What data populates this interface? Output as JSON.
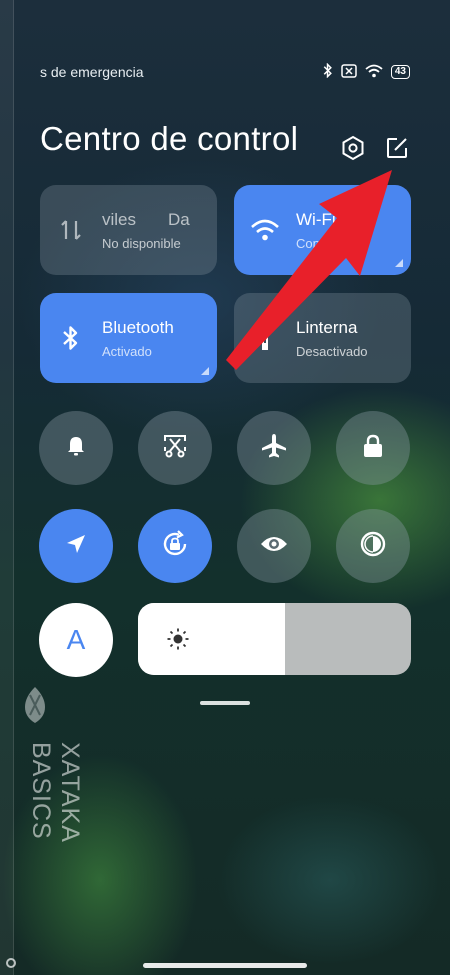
{
  "status_bar": {
    "carrier_text": "s de emergencia",
    "battery_level": "43"
  },
  "panel": {
    "title": "Centro de control"
  },
  "top_actions": [
    {
      "name": "settings",
      "icon": "settings-hexagon-icon"
    },
    {
      "name": "edit",
      "icon": "edit-square-icon"
    }
  ],
  "tiles": {
    "mobile_data": {
      "name": "viles",
      "name_suffix": "Da",
      "state": "No disponible",
      "active": false,
      "icon": "mobile-data-arrows-icon"
    },
    "wifi": {
      "name": "Wi-Fi",
      "state": "Conectado",
      "active": true,
      "icon": "wifi-icon"
    },
    "bluetooth": {
      "name": "Bluetooth",
      "state": "Activado",
      "active": true,
      "icon": "bluetooth-icon"
    },
    "flashlight": {
      "name": "Linterna",
      "state": "Desactivado",
      "active": false,
      "icon": "flashlight-icon"
    }
  },
  "toggles_row1": [
    {
      "name": "sound",
      "icon": "bell-icon",
      "active": false
    },
    {
      "name": "screenshot",
      "icon": "screenshot-scissors-icon",
      "active": false
    },
    {
      "name": "airplane",
      "icon": "airplane-icon",
      "active": false
    },
    {
      "name": "lock",
      "icon": "lock-icon",
      "active": false
    }
  ],
  "toggles_row2": [
    {
      "name": "location",
      "icon": "location-arrow-icon",
      "active": true
    },
    {
      "name": "rotation-lock",
      "icon": "rotation-lock-icon",
      "active": true
    },
    {
      "name": "reading-mode",
      "icon": "eye-icon",
      "active": false
    },
    {
      "name": "dark-mode",
      "icon": "contrast-icon",
      "active": false
    }
  ],
  "auto_brightness": {
    "label": "A"
  },
  "brightness": {
    "level": 0.54,
    "icon": "sun-icon"
  },
  "watermark": {
    "text": "XATAKA BASICS"
  },
  "colors": {
    "accent": "#4a86f0",
    "arrow": "#e8202a"
  }
}
